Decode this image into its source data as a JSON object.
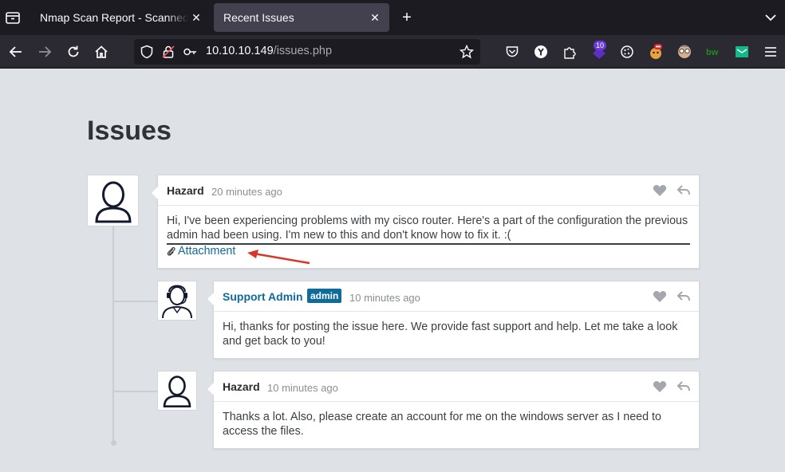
{
  "browser": {
    "tabs": [
      {
        "label": "Nmap Scan Report - Scanned at",
        "close": "✕"
      },
      {
        "label": "Recent Issues",
        "close": "✕"
      }
    ],
    "new_tab": "+",
    "url_host": "10.10.10.149",
    "url_path": "/issues.php",
    "extension_badge": "10"
  },
  "page": {
    "title": "Issues"
  },
  "comments": [
    {
      "author": "Hazard",
      "time": "20 minutes ago",
      "body": "Hi, I've been experiencing problems with my cisco router. Here's a part of the configuration the previous admin had been using. I'm new to this and don't know how to fix it. :(",
      "attachment": "Attachment"
    },
    {
      "author": "Support Admin",
      "role": "admin",
      "time": "10 minutes ago",
      "body": "Hi, thanks for posting the issue here. We provide fast support and help. Let me take a look and get back to you!"
    },
    {
      "author": "Hazard",
      "time": "10 minutes ago",
      "body": "Thanks a lot. Also, please create an account for me on the windows server as I need to access the files."
    }
  ],
  "colors": {
    "link": "#0e6b9a",
    "arrow": "#d9362b",
    "page_bg": "#dee2e6"
  }
}
